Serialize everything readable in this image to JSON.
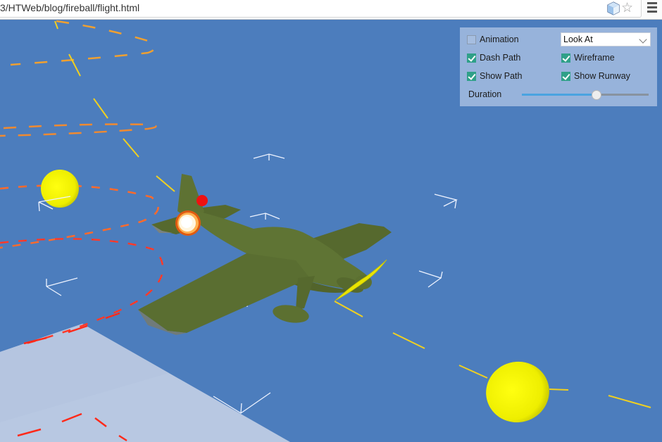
{
  "browser": {
    "url": "3/HTWeb/blog/fireball/flight.html",
    "extension_icon": "cube-icon",
    "bookmark_icon": "star-icon",
    "menu_icon": "hamburger-menu-icon"
  },
  "scene": {
    "background_color": "#4c7dbd",
    "runway_color": "#b8c8e2",
    "airplane_color": "#5a6e31",
    "sphere_color": "#f5f500",
    "flight_path_colors": [
      "#f0a030",
      "#ff6a1a",
      "#ff2a1a",
      "#f0d020"
    ],
    "objects": [
      "airplane",
      "propeller",
      "fireball",
      "red-marker",
      "yellow-sphere-left",
      "yellow-sphere-right",
      "runway",
      "flight-path",
      "wireframe-axes"
    ]
  },
  "controls": {
    "animation": {
      "label": "Animation",
      "checked": false
    },
    "camera_mode": {
      "selected": "Look At"
    },
    "dash_path": {
      "label": "Dash Path",
      "checked": true
    },
    "wireframe": {
      "label": "Wireframe",
      "checked": true
    },
    "show_path": {
      "label": "Show Path",
      "checked": true
    },
    "show_runway": {
      "label": "Show Runway",
      "checked": true
    },
    "duration": {
      "label": "Duration",
      "value_fraction": 0.59
    }
  }
}
